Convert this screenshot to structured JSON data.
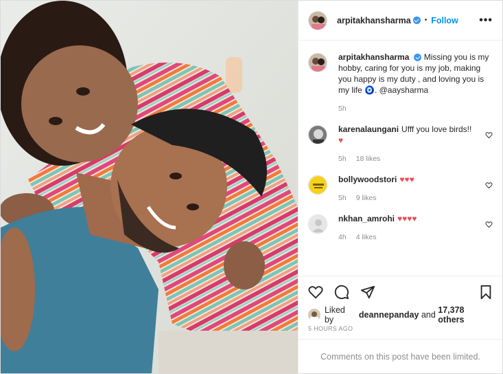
{
  "post": {
    "username": "arpitakhansharma",
    "separator": "•",
    "follow_label": "Follow",
    "more_label": "•••"
  },
  "caption": {
    "username": "arpitakhansharma",
    "text": "Missing you is my hobby, caring for you is my job, making you happy is my duty , and loving you is my life 🧿. @aaysharma",
    "time": "5h"
  },
  "comments": [
    {
      "username": "karenalaungani",
      "text": "Ufff you love birds!! ",
      "hearts": "♥",
      "time": "5h",
      "likes": "18 likes"
    },
    {
      "username": "bollywoodstori",
      "text": "",
      "hearts": "♥♥♥",
      "time": "5h",
      "likes": "9 likes"
    },
    {
      "username": "nkhan_amrohi",
      "text": "",
      "hearts": "♥♥♥♥",
      "time": "4h",
      "likes": "4 likes"
    }
  ],
  "likes": {
    "prefix": "Liked by",
    "user": "deannepanday",
    "middle": "and",
    "count": "17,378 others"
  },
  "timestamp": "5 HOURS AGO",
  "limited_notice": "Comments on this post have been limited.",
  "icons": [
    "heart-icon",
    "comment-icon",
    "share-icon",
    "bookmark-icon"
  ],
  "colors": {
    "link": "#0095f6",
    "verified": "#3897f0",
    "heart": "#ed4956"
  }
}
